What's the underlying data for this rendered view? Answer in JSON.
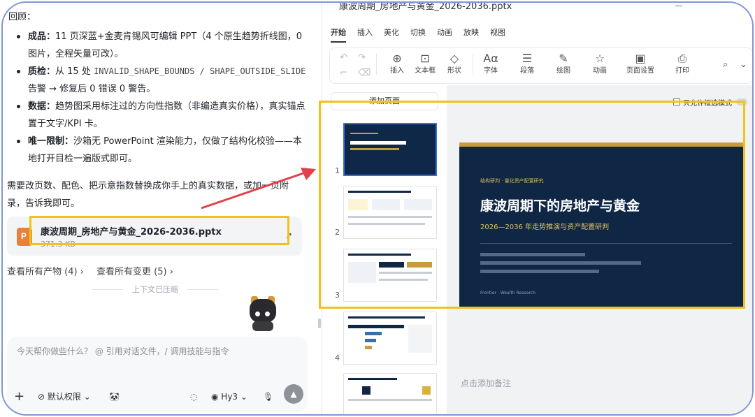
{
  "chat": {
    "header_fragment": "回顾：",
    "bullets": [
      {
        "label": "成品：",
        "text": "11 页深蓝+金麦肯锡风可编辑 PPT（4 个原生趋势折线图，0 图片，全程矢量可改）。"
      },
      {
        "label": "质检：",
        "text_before": "从 15 处 ",
        "code": "INVALID_SHAPE_BOUNDS / SHAPE_OUTSIDE_SLIDE",
        "text_after": " 告警 → 修复后 0 错误 0 警告。"
      },
      {
        "label": "数据：",
        "text": "趋势图采用标注过的方向性指数（非编造真实价格），真实锚点置于文字/KPI 卡。"
      },
      {
        "label": "唯一限制：",
        "text": "沙箱无 PowerPoint 渲染能力，仅做了结构化校验——本地打开目检一遍版式即可。"
      }
    ],
    "followup": "需要改页数、配色、把示意指数替换成你手上的真实数据，或加一页附录，告诉我即可。",
    "file": {
      "name": "康波周期_房地产与黄金_2026-2036.pptx",
      "size": "371.3 KB",
      "open_icon": "arrow-up-right-icon"
    },
    "links": [
      "查看所有产物 (4) ›",
      "查看所有变更 (5) ›"
    ],
    "context_divider": "上下文已压缩",
    "input": {
      "placeholder": "今天帮你做些什么？ @ 引用对话文件，/ 调用技能与指令",
      "plus_label": "+",
      "permission_label": "默认权限 ⌄",
      "model_label": "Hy3 ⌄",
      "send_icon": "up-arrow-icon"
    }
  },
  "ppt": {
    "title": "康波周期_房地产与黄金_2026-2036.pptx",
    "menu": [
      "开始",
      "插入",
      "美化",
      "切换",
      "动画",
      "放映",
      "视图"
    ],
    "active_menu": "开始",
    "toolbar": [
      {
        "icon": "⊕",
        "label": "插入"
      },
      {
        "icon": "⊡",
        "label": "文本框"
      },
      {
        "icon": "◇",
        "label": "形状"
      },
      {
        "icon": "Aα",
        "label": "字体"
      },
      {
        "icon": "☰",
        "label": "段落"
      },
      {
        "icon": "✎",
        "label": "绘图"
      },
      {
        "icon": "☆",
        "label": "动画"
      },
      {
        "icon": "▣",
        "label": "页面设置"
      },
      {
        "icon": "⎙",
        "label": "打印"
      }
    ],
    "add_slide": "添加页面",
    "slide_numbers": [
      "1",
      "2",
      "3",
      "4"
    ],
    "toggle_label": "只允许框选模式",
    "slide": {
      "tag": "结构研判 · 量化资产配置研究",
      "title": "康波周期下的房地产与黄金",
      "subtitle": "2026—2036 年走势推演与资产配置研判",
      "footer": "Frontier · Wealth Research"
    },
    "notes_placeholder": "点击添加备注",
    "colors": {
      "navy": "#0f2745",
      "gold": "#c99b3a",
      "highlight": "#f2c21b",
      "arrow": "#e0414a"
    }
  }
}
